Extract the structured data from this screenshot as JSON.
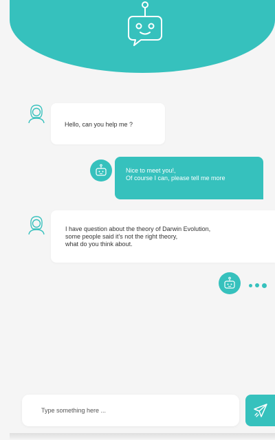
{
  "theme": {
    "accent": "#36c1bd",
    "background": "#f5f5f5",
    "bubble": "#ffffff"
  },
  "header": {
    "icon": "robot-icon"
  },
  "messages": [
    {
      "sender": "user",
      "avatar": "user-avatar-icon",
      "lines": [
        "Hello, can you help me ?"
      ]
    },
    {
      "sender": "bot",
      "avatar": "robot-icon",
      "lines": [
        "Nice to meet you!,",
        "Of course I can, please tell me more"
      ]
    },
    {
      "sender": "user",
      "avatar": "user-avatar-icon",
      "lines": [
        "I have question about the theory of Darwin Evolution,",
        "some people said it's not the right theory,",
        "what do you think about."
      ]
    }
  ],
  "typing": {
    "avatar": "robot-icon",
    "indicator": "typing-dots"
  },
  "composer": {
    "placeholder": "Type something here ...",
    "send_icon": "send-icon"
  }
}
